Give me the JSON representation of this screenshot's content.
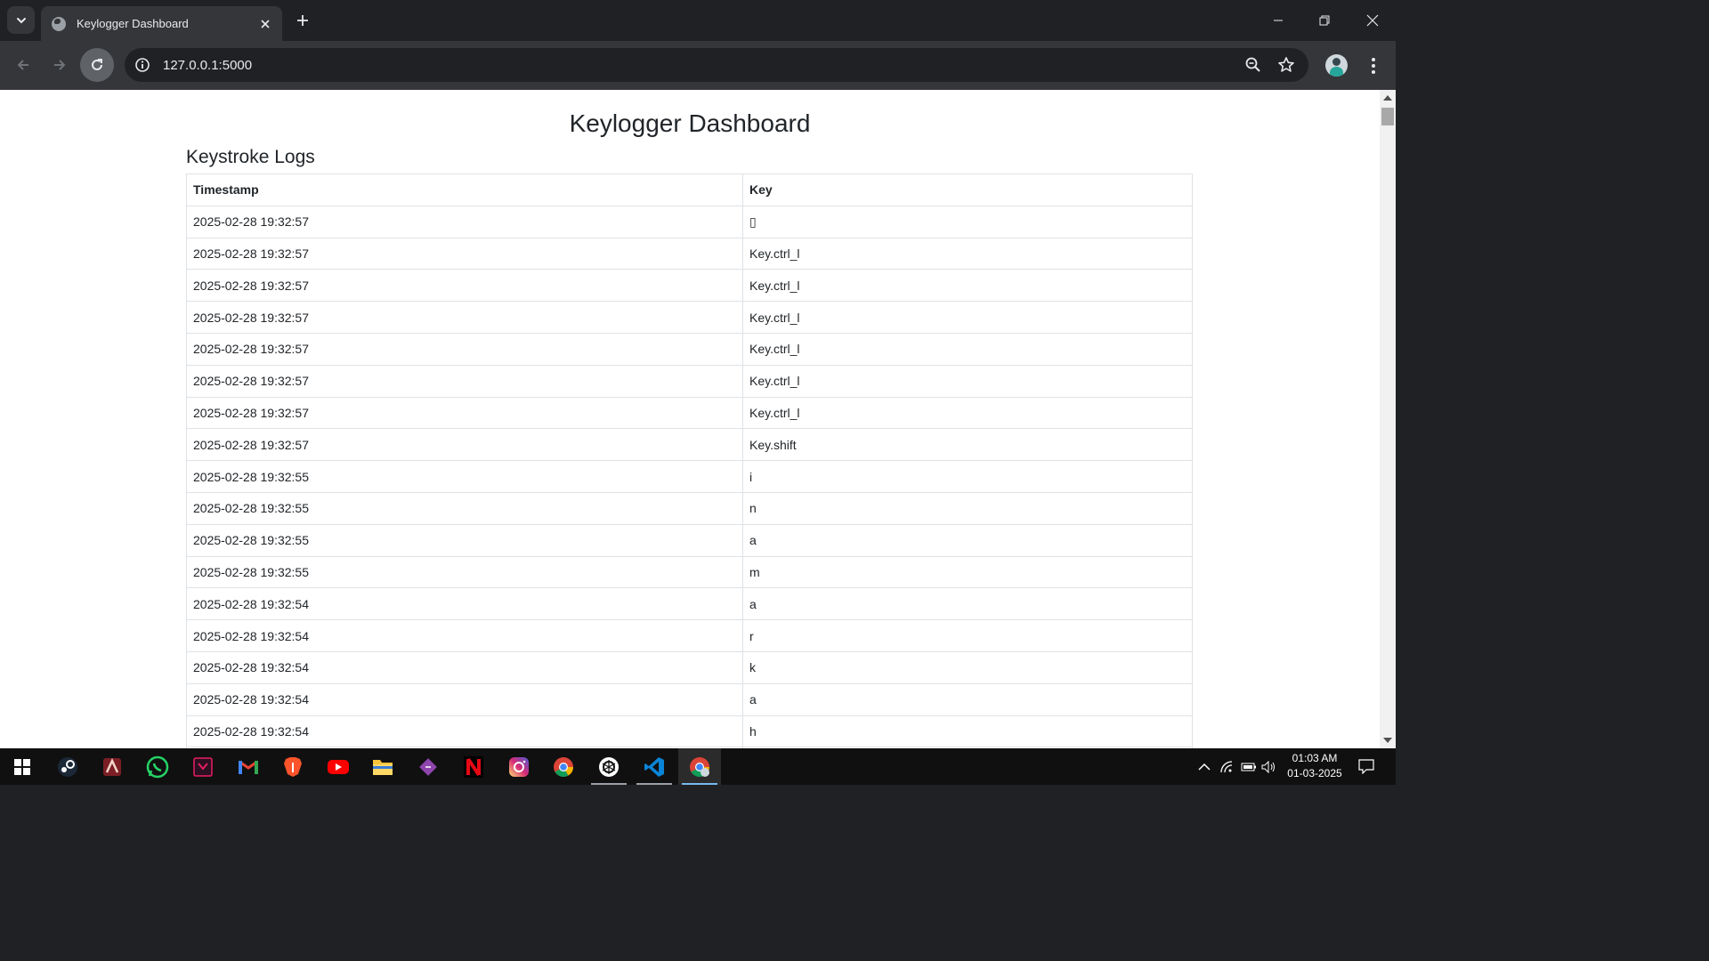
{
  "browser": {
    "tab_title": "Keylogger Dashboard",
    "url": "127.0.0.1:5000"
  },
  "page": {
    "title": "Keylogger Dashboard",
    "section_title": "Keystroke Logs",
    "table": {
      "columns": [
        "Timestamp",
        "Key"
      ],
      "rows": [
        [
          "2025-02-28 19:32:57",
          "▯"
        ],
        [
          "2025-02-28 19:32:57",
          "Key.ctrl_l"
        ],
        [
          "2025-02-28 19:32:57",
          "Key.ctrl_l"
        ],
        [
          "2025-02-28 19:32:57",
          "Key.ctrl_l"
        ],
        [
          "2025-02-28 19:32:57",
          "Key.ctrl_l"
        ],
        [
          "2025-02-28 19:32:57",
          "Key.ctrl_l"
        ],
        [
          "2025-02-28 19:32:57",
          "Key.ctrl_l"
        ],
        [
          "2025-02-28 19:32:57",
          "Key.shift"
        ],
        [
          "2025-02-28 19:32:55",
          "i"
        ],
        [
          "2025-02-28 19:32:55",
          "n"
        ],
        [
          "2025-02-28 19:32:55",
          "a"
        ],
        [
          "2025-02-28 19:32:55",
          "m"
        ],
        [
          "2025-02-28 19:32:54",
          "a"
        ],
        [
          "2025-02-28 19:32:54",
          "r"
        ],
        [
          "2025-02-28 19:32:54",
          "k"
        ],
        [
          "2025-02-28 19:32:54",
          "a"
        ],
        [
          "2025-02-28 19:32:54",
          "h"
        ],
        [
          "",
          ""
        ]
      ]
    }
  },
  "taskbar": {
    "apps": [
      "windows-start",
      "steam",
      "game-app",
      "whatsapp",
      "screen-recorder",
      "gmail",
      "brave",
      "youtube",
      "file-explorer",
      "code-editor",
      "netflix",
      "instagram",
      "chrome",
      "chatgpt",
      "vscode",
      "chrome-profile"
    ],
    "time": "01:03 AM",
    "date": "01-03-2025"
  },
  "colors": {
    "chrome_dark": "#202124",
    "toolbar": "#35363a",
    "text": "#212529",
    "border": "#dee2e6"
  }
}
